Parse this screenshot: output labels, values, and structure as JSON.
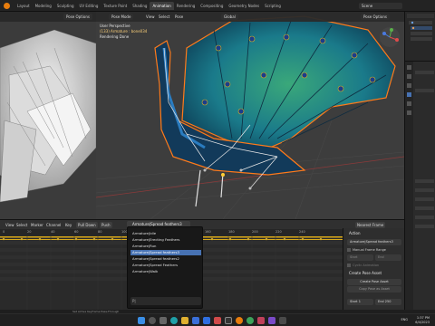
{
  "workspace_tabs": [
    "Layout",
    "Modeling",
    "Sculpting",
    "UV Editing",
    "Texture Paint",
    "Shading",
    "Animation",
    "Rendering",
    "Compositing",
    "Geometry Nodes",
    "Scripting"
  ],
  "active_tab": "Animation",
  "scene_name": "Scene",
  "left_view": {
    "pose_options": "Pose Options"
  },
  "main_view": {
    "mode": "Pose Mode",
    "menus": [
      "View",
      "Select",
      "Pose"
    ],
    "orientation": "Global",
    "pose_options": "Pose Options",
    "info_line1": "User Perspective",
    "info_line2": "(133) Armature : bone034",
    "info_line3": "Rendering Done"
  },
  "dopesheet": {
    "menus": [
      "View",
      "Select",
      "Marker",
      "Channel",
      "Key"
    ],
    "pull_down": "Pull Down",
    "push": "Push",
    "action_name": "Armature|Spread feathers3",
    "ruler": [
      "0",
      "20",
      "40",
      "60",
      "80",
      "100",
      "120",
      "140",
      "160",
      "180",
      "200",
      "220",
      "240"
    ],
    "interp": "Nearest Frame"
  },
  "dropdown": {
    "items": [
      "Armature|Idle",
      "Armature|Erecting Feathers",
      "Armature|Run",
      "Armature|Spread feathers3",
      "Armature|Spread feathers2",
      "Armature|Spread Feathers",
      "Armature|Walk"
    ],
    "selected_index": 3,
    "search_placeholder": "P|"
  },
  "sidepanel": {
    "section": "Action",
    "action_field": "Armature|Spread feathers3",
    "manual_frame_range": "Manual Frame Range",
    "start_label": "Start",
    "end_label": "End",
    "cyclic": "Cyclic Animation",
    "create_pose_asset": "Create Pose Asset",
    "create_pose_asset_btn": "Create Pose Asset",
    "copy_pose_asset": "Copy Pose as Asset",
    "start": "Start",
    "start_value": "1",
    "end": "End",
    "end_value": "250"
  },
  "status": "Set Active Keyframe Pass-Through",
  "taskbar": {
    "lang": "ENG",
    "time": "1:37 PM",
    "date": "6/4/2023"
  },
  "colors": {
    "accent_blue": "#4772b3",
    "blender_orange": "#e87d0d",
    "key_yellow": "#d9a91a"
  }
}
